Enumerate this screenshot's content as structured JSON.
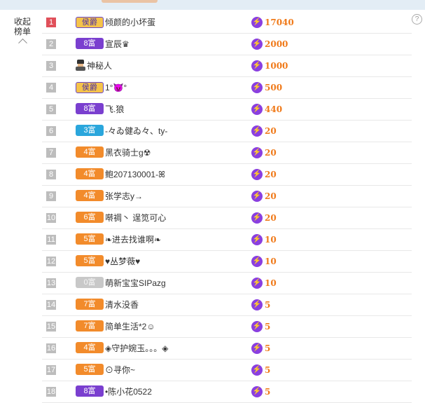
{
  "panel": {
    "collapse_line1": "收起",
    "collapse_line2": "榜单",
    "help_icon": "?"
  },
  "rows": [
    {
      "rank": "1",
      "badge": "侯爵",
      "badge_type": "noble",
      "name": "倾颜的小坏蛋",
      "score": "17040"
    },
    {
      "rank": "2",
      "badge": "8富",
      "badge_type": "rich8",
      "name": "宣辰♛",
      "score": "2000"
    },
    {
      "rank": "3",
      "badge": "",
      "badge_type": "mystery",
      "name": "神秘人",
      "score": "1000"
    },
    {
      "rank": "4",
      "badge": "侯爵",
      "badge_type": "noble",
      "name": "1°😈°",
      "score": "500"
    },
    {
      "rank": "5",
      "badge": "8富",
      "badge_type": "rich8",
      "name": "飞.狼",
      "score": "440"
    },
    {
      "rank": "6",
      "badge": "3富",
      "badge_type": "rich3",
      "name": "-々ゐ健ゐ々、ty-",
      "score": "20"
    },
    {
      "rank": "7",
      "badge": "4富",
      "badge_type": "rich4",
      "name": "黑衣骑士g☢",
      "score": "20"
    },
    {
      "rank": "8",
      "badge": "4富",
      "badge_type": "rich4",
      "name": "鲍207130001-ꕤ",
      "score": "20"
    },
    {
      "rank": "9",
      "badge": "4富",
      "badge_type": "rich4",
      "name": "张学志y→",
      "score": "20"
    },
    {
      "rank": "10",
      "badge": "6富",
      "badge_type": "rich6",
      "name": "啭禂丶 逞笕可心",
      "score": "20"
    },
    {
      "rank": "11",
      "badge": "5富",
      "badge_type": "rich5",
      "name": "❧进去找谁啊❧",
      "score": "10"
    },
    {
      "rank": "12",
      "badge": "5富",
      "badge_type": "rich5",
      "name": "♥丛梦薇♥",
      "score": "10"
    },
    {
      "rank": "13",
      "badge": "0富",
      "badge_type": "rich0",
      "name": "萌新宝宝SIPazg",
      "score": "10"
    },
    {
      "rank": "14",
      "badge": "7富",
      "badge_type": "rich7",
      "name": "清水没香",
      "score": "5"
    },
    {
      "rank": "15",
      "badge": "7富",
      "badge_type": "rich7",
      "name": "简单生活*2☺",
      "score": "5"
    },
    {
      "rank": "16",
      "badge": "4富",
      "badge_type": "rich4",
      "name": "◈守护婉玉。。。◈",
      "score": "5"
    },
    {
      "rank": "17",
      "badge": "5富",
      "badge_type": "rich5",
      "name": "⊙寻你~",
      "score": "5"
    },
    {
      "rank": "18",
      "badge": "8富",
      "badge_type": "rich8",
      "name": "•陈小花0522",
      "score": "5"
    }
  ],
  "colors": {
    "score": "#f07a1a",
    "bolt": "#8a3fe0",
    "rank_top": "#e0505a",
    "rank_default": "#bdbdbd"
  },
  "icons": {
    "score_icon": "lightning-icon",
    "collapse_icon": "chevron-up-icon"
  }
}
